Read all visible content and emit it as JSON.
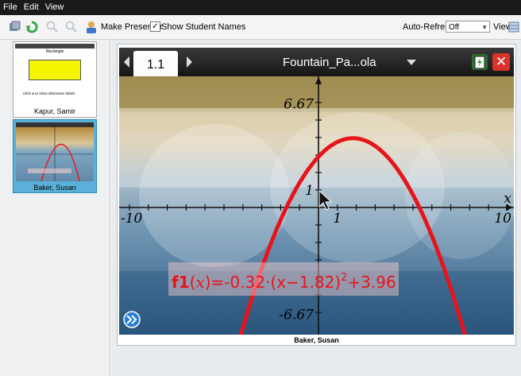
{
  "menubar": {
    "items": [
      "File",
      "Edit",
      "View"
    ]
  },
  "toolbar": {
    "make_presenter": "Make Presenter",
    "show_student_names": "Show Student Names",
    "show_student_names_checked": true,
    "auto_refresh_label": "Auto-Refresh:",
    "auto_refresh_value": "Off",
    "view_label": "View"
  },
  "students": [
    {
      "name": "Kapur, Samir",
      "thumb_title": "Rectangle",
      "thumb_hint": "Click & to show dimension labels"
    },
    {
      "name": "Baker, Susan"
    }
  ],
  "selected_student": "Baker, Susan",
  "document": {
    "tab": "1.1",
    "title": "Fountain_Pa...ola",
    "graph": {
      "xlim": [
        -10,
        10
      ],
      "ylim": [
        -6.67,
        6.67
      ],
      "labels": {
        "ymax": "6.67",
        "ymin": "-6.67",
        "xmin": "-10",
        "xmax": "10",
        "one_x": "1",
        "one_y": "1",
        "x_axis": "x"
      },
      "function": {
        "name": "f1",
        "a": -0.32,
        "h": 1.82,
        "k": 3.96
      },
      "equation": {
        "prefix": "f1",
        "var": "x",
        "eq": "=-0.32·(x−1.82)",
        "exp": "2",
        "tail": "+3.96"
      },
      "curve_color": "#e8141b"
    }
  }
}
